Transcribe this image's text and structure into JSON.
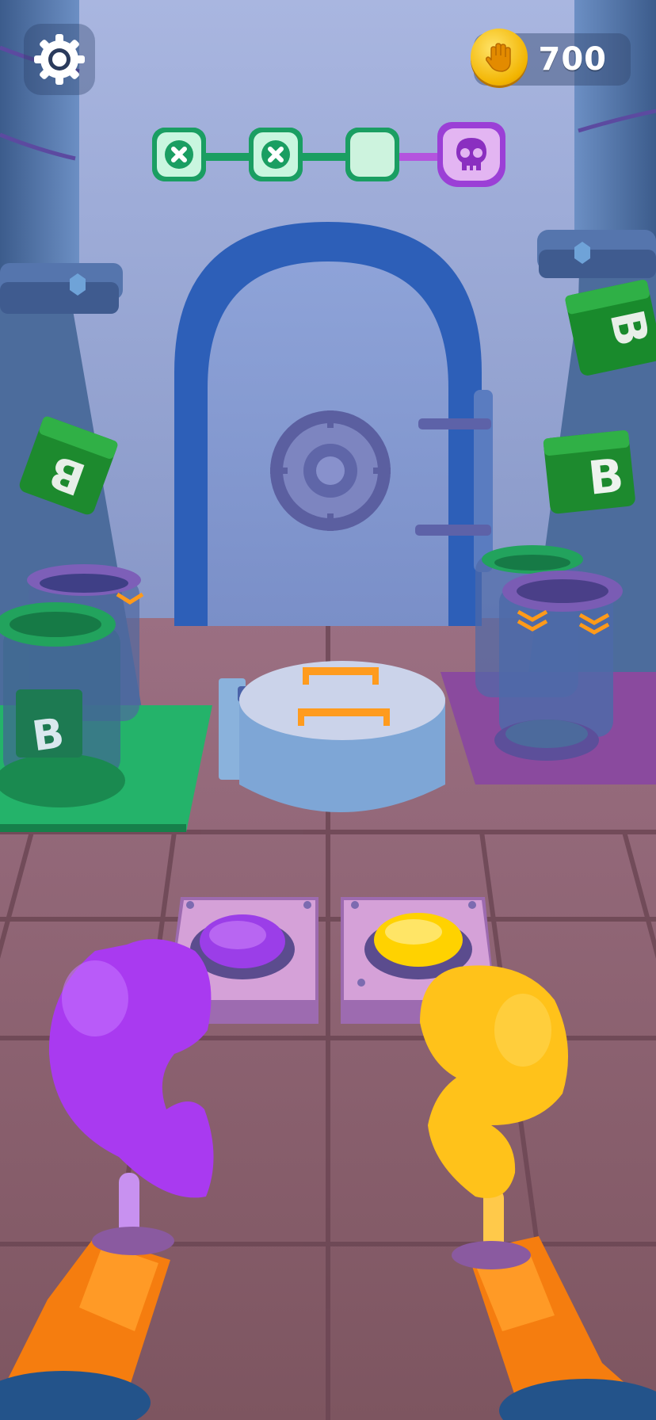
{
  "hud": {
    "coins": "700",
    "settings_icon": "gear-icon",
    "coin_icon": "hand-coin-icon"
  },
  "level_progress": {
    "stages": [
      {
        "state": "failed",
        "icon": "x-icon"
      },
      {
        "state": "failed",
        "icon": "x-icon"
      },
      {
        "state": "current",
        "icon": "blank"
      },
      {
        "state": "boss",
        "icon": "skull-icon"
      }
    ]
  },
  "scene": {
    "blocks": [
      "B",
      "B",
      "B",
      "B"
    ],
    "buttons": [
      {
        "color": "#9b3ee8",
        "name": "purple"
      },
      {
        "color": "#ffd200",
        "name": "yellow"
      }
    ],
    "colors": {
      "purple": "#a93af0",
      "yellow": "#ffc21a",
      "green": "#21a15d"
    }
  }
}
